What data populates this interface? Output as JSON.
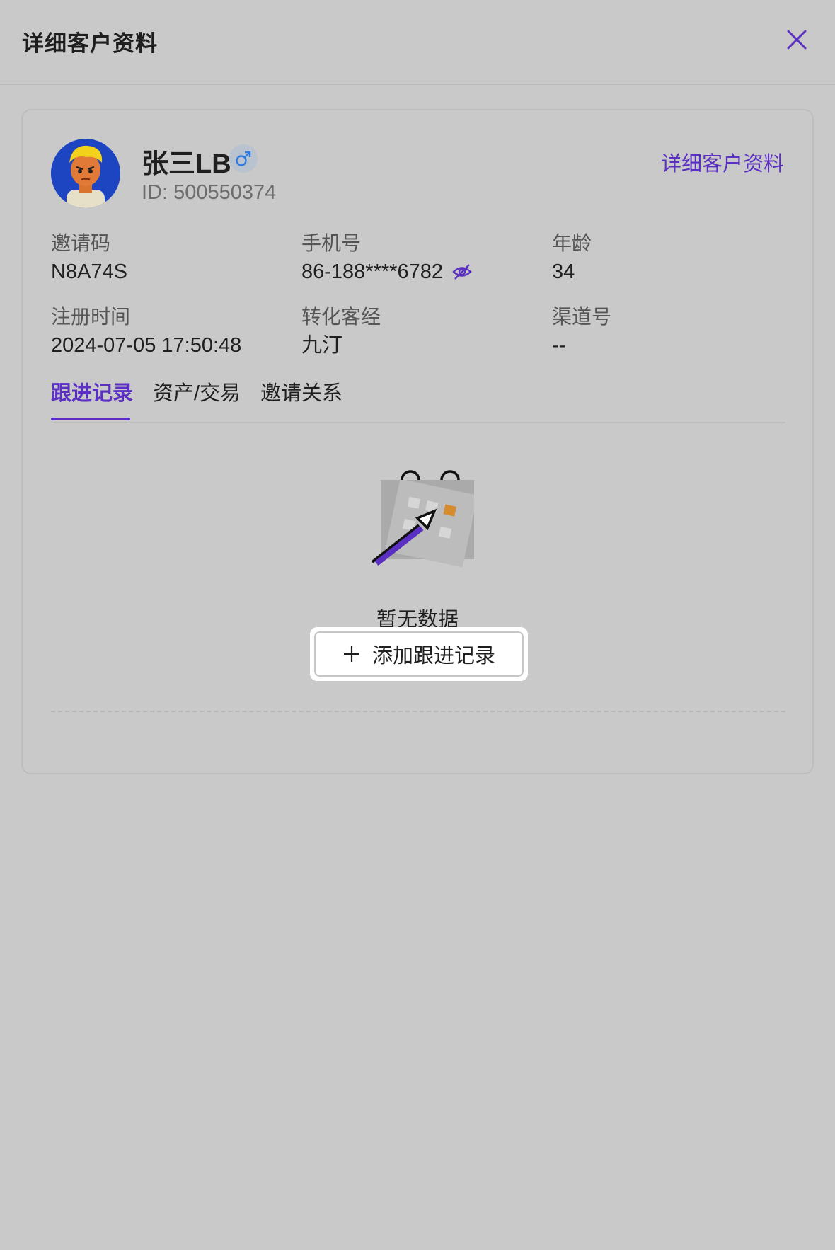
{
  "header": {
    "title": "详细客户资料"
  },
  "profile": {
    "name": "张三LB",
    "gender_symbol": "♂",
    "id_text": "ID: 500550374",
    "detail_link": "详细客户资料"
  },
  "fields": [
    {
      "label": "邀请码",
      "value": "N8A74S"
    },
    {
      "label": "手机号",
      "value": "86-188****6782"
    },
    {
      "label": "年龄",
      "value": "34"
    },
    {
      "label": "注册时间",
      "value": "2024-07-05 17:50:48"
    },
    {
      "label": "转化客经",
      "value": "九汀"
    },
    {
      "label": "渠道号",
      "value": "--"
    }
  ],
  "tabs": [
    {
      "label": "跟进记录",
      "active": true
    },
    {
      "label": "资产/交易",
      "active": false
    },
    {
      "label": "邀请关系",
      "active": false
    }
  ],
  "empty": {
    "text": "暂无数据",
    "add_button": "添加跟进记录"
  },
  "colors": {
    "accent": "#5a2fc2",
    "background": "#c9c9c9",
    "gender_badge": "#b9c3cf"
  },
  "icons": {
    "close": "close-icon",
    "gender": "male-icon",
    "eye": "eye-off-icon",
    "plus": "plus-icon",
    "empty": "empty-calendar-illustration"
  }
}
